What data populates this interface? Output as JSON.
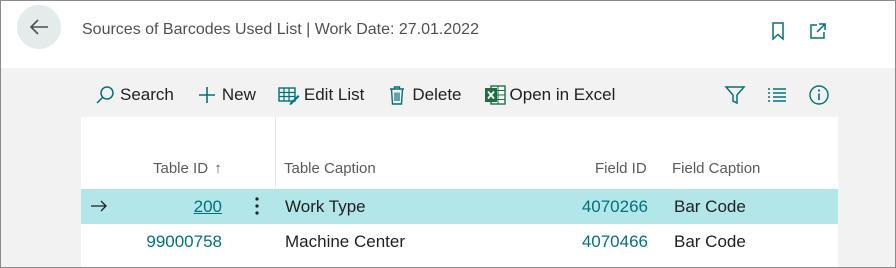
{
  "header": {
    "title": "Sources of Barcodes Used List | Work Date: 27.01.2022"
  },
  "actions": {
    "search": "Search",
    "new": "New",
    "edit_list": "Edit List",
    "delete": "Delete",
    "open_excel": "Open in Excel"
  },
  "table": {
    "columns": {
      "table_id": "Table ID",
      "table_id_sort": "↑",
      "table_caption": "Table Caption",
      "field_id": "Field ID",
      "field_caption": "Field Caption"
    },
    "rows": [
      {
        "table_id": "200",
        "table_caption": "Work Type",
        "field_id": "4070266",
        "field_caption": "Bar Code"
      },
      {
        "table_id": "99000758",
        "table_caption": "Machine Center",
        "field_id": "4070466",
        "field_caption": "Bar Code"
      }
    ]
  },
  "colors": {
    "accent": "#00727a",
    "selected_row": "#b3e6e8"
  }
}
